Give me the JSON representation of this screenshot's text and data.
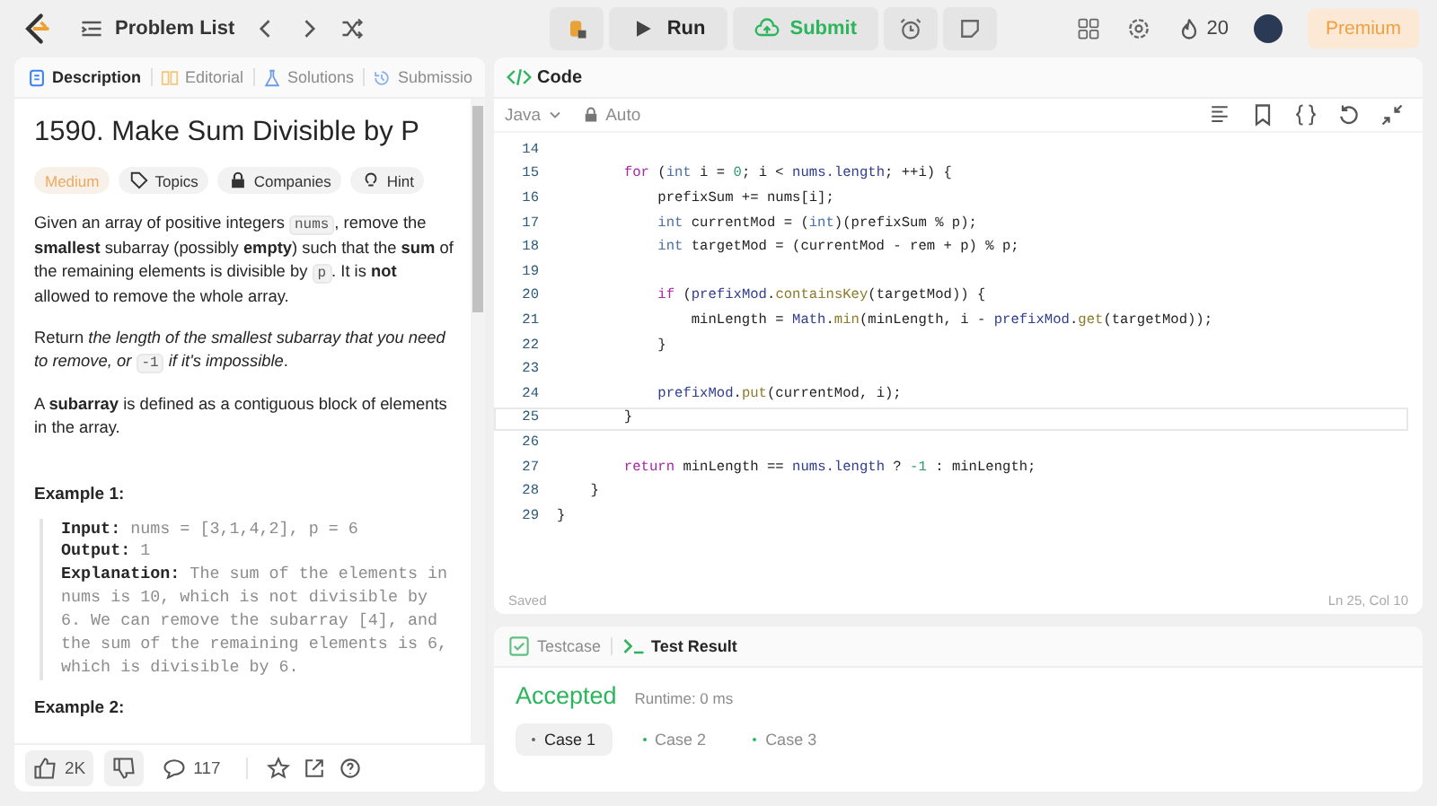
{
  "topbar": {
    "problem_list": "Problem List",
    "run": "Run",
    "submit": "Submit",
    "streak": "20",
    "premium": "Premium"
  },
  "left_tabs": [
    {
      "label": "Description",
      "selected": true
    },
    {
      "label": "Editorial",
      "selected": false
    },
    {
      "label": "Solutions",
      "selected": false
    },
    {
      "label": "Submissio",
      "selected": false
    }
  ],
  "problem": {
    "title": "1590. Make Sum Divisible by P",
    "difficulty": "Medium",
    "tags": [
      "Topics",
      "Companies",
      "Hint"
    ],
    "paragraphs": [
      [
        {
          "kind": "text",
          "text": "Given an array of positive integers "
        },
        {
          "kind": "code",
          "text": "nums"
        },
        {
          "kind": "text",
          "text": ", remove the **smallest** subarray (possibly **empty**) such that the **sum** of the remaining elements is divisible by "
        },
        {
          "kind": "code",
          "text": "p"
        },
        {
          "kind": "text",
          "text": ". It is **not** allowed to remove the whole array."
        }
      ],
      [
        {
          "kind": "text",
          "text": "Return *the length of the smallest subarray that you need to remove, or* "
        },
        {
          "kind": "code",
          "text": "-1"
        },
        {
          "kind": "text",
          "text": " *if it's impossible*."
        }
      ],
      [
        {
          "kind": "text",
          "text": "A **subarray** is defined as a contiguous block of elements in the array."
        }
      ]
    ],
    "example_title": "Example 1:",
    "example_lines": [
      {
        "label": "Input:",
        "value": "nums = [3,1,4,2], p = 6"
      },
      {
        "label": "Output:",
        "value": "1"
      },
      {
        "label": "Explanation:",
        "value": "The sum of the elements in nums is 10, which is not divisible by 6. We can remove the subarray [4], and the sum of the remaining elements is 6, which is divisible by 6."
      }
    ],
    "next_example_title": "Example 2:"
  },
  "footer": {
    "likes": "2K",
    "comments": "117"
  },
  "code_panel": {
    "tab": "Code",
    "language": "Java",
    "mode": "Auto",
    "status": "Saved",
    "cursor": "Ln 25, Col 10",
    "lines": [
      {
        "number": "14",
        "current": false
      },
      {
        "number": "15",
        "current": false,
        "tokens": [
          {
            "kind": "kw",
            "text": "        for"
          },
          {
            "kind": "p",
            "text": " ("
          },
          {
            "kind": "ty",
            "text": "int"
          },
          {
            "kind": "p",
            "text": " i = "
          },
          {
            "kind": "num",
            "text": "0"
          },
          {
            "kind": "p",
            "text": "; i < "
          },
          {
            "kind": "var",
            "text": "nums.length"
          },
          {
            "kind": "p",
            "text": "; ++i) {"
          }
        ]
      },
      {
        "number": "16",
        "current": false,
        "tokens": [
          {
            "kind": "p",
            "text": "            prefixSum += nums[i];"
          }
        ]
      },
      {
        "number": "17",
        "current": false,
        "tokens": [
          {
            "kind": "ty",
            "text": "            int"
          },
          {
            "kind": "p",
            "text": " currentMod = ("
          },
          {
            "kind": "ty",
            "text": "int"
          },
          {
            "kind": "p",
            "text": ")(prefixSum % p);"
          }
        ]
      },
      {
        "number": "18",
        "current": false,
        "tokens": [
          {
            "kind": "ty",
            "text": "            int"
          },
          {
            "kind": "p",
            "text": " targetMod = (currentMod - rem + p) % p;"
          }
        ]
      },
      {
        "number": "19",
        "current": false
      },
      {
        "number": "20",
        "current": false,
        "tokens": [
          {
            "kind": "kw",
            "text": "            if"
          },
          {
            "kind": "p",
            "text": " ("
          },
          {
            "kind": "var",
            "text": "prefixMod"
          },
          {
            "kind": "p",
            "text": "."
          },
          {
            "kind": "fn",
            "text": "containsKey"
          },
          {
            "kind": "p",
            "text": "(targetMod)) {"
          }
        ]
      },
      {
        "number": "21",
        "current": false,
        "tokens": [
          {
            "kind": "p",
            "text": "                minLength = "
          },
          {
            "kind": "var",
            "text": "Math"
          },
          {
            "kind": "p",
            "text": "."
          },
          {
            "kind": "fn",
            "text": "min"
          },
          {
            "kind": "p",
            "text": "(minLength, i - "
          },
          {
            "kind": "var",
            "text": "prefixMod"
          },
          {
            "kind": "p",
            "text": "."
          },
          {
            "kind": "fn",
            "text": "get"
          },
          {
            "kind": "p",
            "text": "(targetMod));"
          }
        ]
      },
      {
        "number": "22",
        "current": false,
        "tokens": [
          {
            "kind": "p",
            "text": "            }"
          }
        ]
      },
      {
        "number": "23",
        "current": false
      },
      {
        "number": "24",
        "current": false,
        "tokens": [
          {
            "kind": "var",
            "text": "            prefixMod"
          },
          {
            "kind": "p",
            "text": "."
          },
          {
            "kind": "fn",
            "text": "put"
          },
          {
            "kind": "p",
            "text": "(currentMod, i);"
          }
        ]
      },
      {
        "number": "25",
        "current": true,
        "tokens": [
          {
            "kind": "p",
            "text": "        }"
          }
        ]
      },
      {
        "number": "26",
        "current": false
      },
      {
        "number": "27",
        "current": false,
        "tokens": [
          {
            "kind": "kw",
            "text": "        return"
          },
          {
            "kind": "p",
            "text": " minLength == "
          },
          {
            "kind": "var",
            "text": "nums.length"
          },
          {
            "kind": "p",
            "text": " ? "
          },
          {
            "kind": "num",
            "text": "-1"
          },
          {
            "kind": "p",
            "text": " : minLength;"
          }
        ]
      },
      {
        "number": "28",
        "current": false,
        "tokens": [
          {
            "kind": "p",
            "text": "    }"
          }
        ]
      },
      {
        "number": "29",
        "current": false,
        "tokens": [
          {
            "kind": "p",
            "text": "}"
          }
        ]
      }
    ]
  },
  "result_panel": {
    "tabs": [
      {
        "label": "Testcase",
        "selected": false
      },
      {
        "label": "Test Result",
        "selected": true
      }
    ],
    "verdict": "Accepted",
    "runtime": "Runtime: 0 ms",
    "cases": [
      {
        "label": "Case 1",
        "selected": true
      },
      {
        "label": "Case 2",
        "selected": false
      },
      {
        "label": "Case 3",
        "selected": false
      }
    ]
  }
}
